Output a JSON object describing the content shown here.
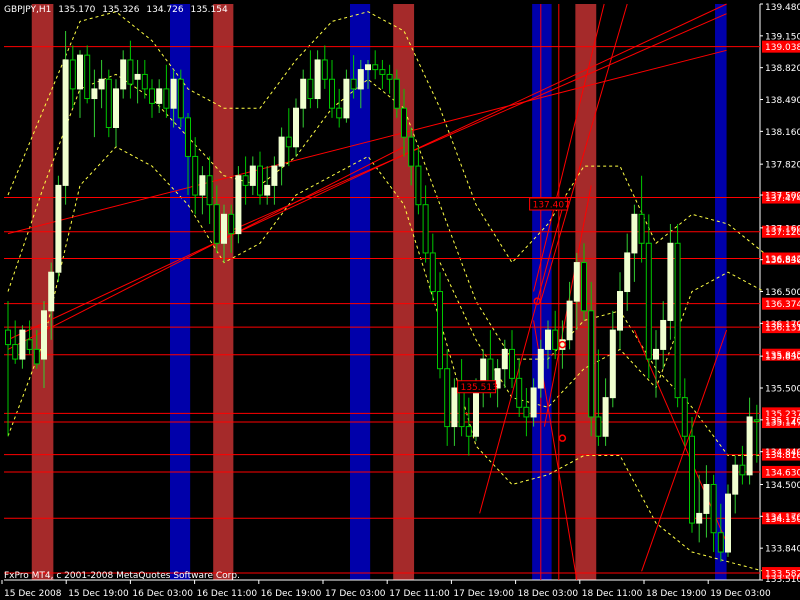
{
  "window": {
    "symbol": "GBPJPY,H1",
    "ohlc": [
      "135.170",
      "135.326",
      "134.726",
      "135.154"
    ],
    "copyright": "FxPro MT4, c 2001-2008 MetaQuotes Software Corp."
  },
  "colors": {
    "background": "#000000",
    "bull_body": "#f0ffd0",
    "bear_body": "#000000",
    "wick_bull": "#32cd32",
    "wick_bear": "#00c800",
    "band": "#ffff44",
    "line": "#ff0000",
    "red_zone": "#a52a2a",
    "blue_zone": "#0000aa",
    "label_bg": "#ff0000",
    "label_text": "#ffffff",
    "axis": "#ffffff"
  },
  "chart_data": {
    "type": "candlestick",
    "ylim": [
      133.51,
      139.48
    ],
    "y_ticks": [
      "139.480",
      "139.150",
      "138.820",
      "138.490",
      "138.160",
      "137.820",
      "137.500",
      "137.160",
      "136.830",
      "136.500",
      "136.170",
      "135.830",
      "135.500",
      "135.170",
      "134.840",
      "134.500",
      "134.170",
      "133.840",
      "133.510"
    ],
    "x_ticks": [
      "15 Dec 2008",
      "15 Dec 19:00",
      "16 Dec 03:00",
      "16 Dec 11:00",
      "16 Dec 19:00",
      "17 Dec 03:00",
      "17 Dec 11:00",
      "17 Dec 19:00",
      "18 Dec 03:00",
      "18 Dec 11:00",
      "18 Dec 19:00",
      "19 Dec 03:00"
    ],
    "candles": [
      {
        "t": 0,
        "o": 136.1,
        "h": 136.4,
        "l": 135.0,
        "c": 135.95
      },
      {
        "t": 1,
        "o": 135.95,
        "h": 136.2,
        "l": 135.75,
        "c": 135.8
      },
      {
        "t": 2,
        "o": 135.8,
        "h": 136.15,
        "l": 135.7,
        "c": 136.1
      },
      {
        "t": 3,
        "o": 136.0,
        "h": 136.2,
        "l": 135.85,
        "c": 135.9
      },
      {
        "t": 4,
        "o": 135.9,
        "h": 136.1,
        "l": 135.7,
        "c": 135.75
      },
      {
        "t": 5,
        "o": 135.8,
        "h": 136.4,
        "l": 135.5,
        "c": 136.3
      },
      {
        "t": 6,
        "o": 136.3,
        "h": 136.8,
        "l": 136.0,
        "c": 136.7
      },
      {
        "t": 7,
        "o": 136.7,
        "h": 137.7,
        "l": 136.6,
        "c": 137.6
      },
      {
        "t": 8,
        "o": 137.6,
        "h": 139.2,
        "l": 137.4,
        "c": 138.9
      },
      {
        "t": 9,
        "o": 138.9,
        "h": 139.05,
        "l": 138.4,
        "c": 138.6
      },
      {
        "t": 10,
        "o": 138.6,
        "h": 139.0,
        "l": 138.3,
        "c": 138.95
      },
      {
        "t": 11,
        "o": 138.95,
        "h": 139.05,
        "l": 138.45,
        "c": 138.5
      },
      {
        "t": 12,
        "o": 138.5,
        "h": 138.8,
        "l": 138.1,
        "c": 138.6
      },
      {
        "t": 13,
        "o": 138.6,
        "h": 138.9,
        "l": 138.4,
        "c": 138.7
      },
      {
        "t": 14,
        "o": 138.7,
        "h": 138.8,
        "l": 138.1,
        "c": 138.2
      },
      {
        "t": 15,
        "o": 138.2,
        "h": 138.7,
        "l": 138.0,
        "c": 138.6
      },
      {
        "t": 16,
        "o": 138.6,
        "h": 139.0,
        "l": 138.5,
        "c": 138.9
      },
      {
        "t": 17,
        "o": 138.9,
        "h": 139.1,
        "l": 138.5,
        "c": 138.65
      },
      {
        "t": 18,
        "o": 138.7,
        "h": 138.9,
        "l": 138.45,
        "c": 138.75
      },
      {
        "t": 19,
        "o": 138.75,
        "h": 138.9,
        "l": 138.5,
        "c": 138.6
      },
      {
        "t": 20,
        "o": 138.6,
        "h": 138.7,
        "l": 138.3,
        "c": 138.45
      },
      {
        "t": 21,
        "o": 138.45,
        "h": 138.7,
        "l": 138.35,
        "c": 138.6
      },
      {
        "t": 22,
        "o": 138.6,
        "h": 138.85,
        "l": 138.3,
        "c": 138.4
      },
      {
        "t": 23,
        "o": 138.4,
        "h": 138.8,
        "l": 138.2,
        "c": 138.7
      },
      {
        "t": 24,
        "o": 138.7,
        "h": 138.8,
        "l": 138.2,
        "c": 138.3
      },
      {
        "t": 25,
        "o": 138.3,
        "h": 138.35,
        "l": 137.5,
        "c": 137.9
      },
      {
        "t": 26,
        "o": 137.9,
        "h": 138.1,
        "l": 137.3,
        "c": 137.5
      },
      {
        "t": 27,
        "o": 137.5,
        "h": 137.8,
        "l": 137.3,
        "c": 137.7
      },
      {
        "t": 28,
        "o": 137.7,
        "h": 137.9,
        "l": 137.2,
        "c": 137.4
      },
      {
        "t": 29,
        "o": 137.4,
        "h": 137.6,
        "l": 136.9,
        "c": 137.0
      },
      {
        "t": 30,
        "o": 137.0,
        "h": 137.4,
        "l": 136.8,
        "c": 137.3
      },
      {
        "t": 31,
        "o": 137.3,
        "h": 137.4,
        "l": 136.9,
        "c": 137.1
      },
      {
        "t": 32,
        "o": 137.1,
        "h": 137.8,
        "l": 137.0,
        "c": 137.7
      },
      {
        "t": 33,
        "o": 137.7,
        "h": 137.9,
        "l": 137.4,
        "c": 137.6
      },
      {
        "t": 34,
        "o": 137.6,
        "h": 137.9,
        "l": 137.5,
        "c": 137.8
      },
      {
        "t": 35,
        "o": 137.8,
        "h": 137.95,
        "l": 137.4,
        "c": 137.5
      },
      {
        "t": 36,
        "o": 137.5,
        "h": 137.8,
        "l": 137.4,
        "c": 137.6
      },
      {
        "t": 37,
        "o": 137.6,
        "h": 137.9,
        "l": 137.4,
        "c": 137.8
      },
      {
        "t": 38,
        "o": 137.8,
        "h": 138.2,
        "l": 137.6,
        "c": 138.1
      },
      {
        "t": 39,
        "o": 138.1,
        "h": 138.4,
        "l": 137.8,
        "c": 138.0
      },
      {
        "t": 40,
        "o": 138.0,
        "h": 138.5,
        "l": 137.9,
        "c": 138.4
      },
      {
        "t": 41,
        "o": 138.4,
        "h": 138.8,
        "l": 138.2,
        "c": 138.7
      },
      {
        "t": 42,
        "o": 138.7,
        "h": 139.0,
        "l": 138.4,
        "c": 138.5
      },
      {
        "t": 43,
        "o": 138.5,
        "h": 139.0,
        "l": 138.4,
        "c": 138.9
      },
      {
        "t": 44,
        "o": 138.9,
        "h": 139.05,
        "l": 138.6,
        "c": 138.7
      },
      {
        "t": 45,
        "o": 138.7,
        "h": 138.9,
        "l": 138.3,
        "c": 138.4
      },
      {
        "t": 46,
        "o": 138.4,
        "h": 138.6,
        "l": 138.2,
        "c": 138.3
      },
      {
        "t": 47,
        "o": 138.3,
        "h": 138.8,
        "l": 138.25,
        "c": 138.7
      },
      {
        "t": 48,
        "o": 138.7,
        "h": 138.95,
        "l": 138.5,
        "c": 138.6
      },
      {
        "t": 49,
        "o": 138.6,
        "h": 138.9,
        "l": 138.4,
        "c": 138.8
      },
      {
        "t": 50,
        "o": 138.8,
        "h": 138.9,
        "l": 138.6,
        "c": 138.85
      },
      {
        "t": 51,
        "o": 138.85,
        "h": 139.0,
        "l": 138.7,
        "c": 138.8
      },
      {
        "t": 52,
        "o": 138.8,
        "h": 138.9,
        "l": 138.6,
        "c": 138.75
      },
      {
        "t": 53,
        "o": 138.75,
        "h": 138.85,
        "l": 138.55,
        "c": 138.7
      },
      {
        "t": 54,
        "o": 138.7,
        "h": 138.8,
        "l": 138.3,
        "c": 138.4
      },
      {
        "t": 55,
        "o": 138.4,
        "h": 138.6,
        "l": 137.9,
        "c": 138.1
      },
      {
        "t": 56,
        "o": 138.1,
        "h": 138.2,
        "l": 137.6,
        "c": 137.8
      },
      {
        "t": 57,
        "o": 137.8,
        "h": 138.0,
        "l": 137.3,
        "c": 137.4
      },
      {
        "t": 58,
        "o": 137.4,
        "h": 137.6,
        "l": 136.8,
        "c": 136.9
      },
      {
        "t": 59,
        "o": 136.9,
        "h": 137.1,
        "l": 136.4,
        "c": 136.5
      },
      {
        "t": 60,
        "o": 136.5,
        "h": 136.7,
        "l": 135.6,
        "c": 135.7
      },
      {
        "t": 61,
        "o": 135.7,
        "h": 135.9,
        "l": 134.9,
        "c": 135.1
      },
      {
        "t": 62,
        "o": 135.1,
        "h": 135.6,
        "l": 134.9,
        "c": 135.5
      },
      {
        "t": 63,
        "o": 135.5,
        "h": 135.8,
        "l": 135.0,
        "c": 135.1
      },
      {
        "t": 64,
        "o": 135.1,
        "h": 135.4,
        "l": 134.8,
        "c": 135.0
      },
      {
        "t": 65,
        "o": 135.0,
        "h": 135.6,
        "l": 134.95,
        "c": 135.5
      },
      {
        "t": 66,
        "o": 135.5,
        "h": 135.9,
        "l": 135.3,
        "c": 135.8
      },
      {
        "t": 67,
        "o": 135.8,
        "h": 136.1,
        "l": 135.4,
        "c": 135.5
      },
      {
        "t": 68,
        "o": 135.5,
        "h": 135.8,
        "l": 135.3,
        "c": 135.7
      },
      {
        "t": 69,
        "o": 135.7,
        "h": 136.0,
        "l": 135.5,
        "c": 135.9
      },
      {
        "t": 70,
        "o": 135.9,
        "h": 136.1,
        "l": 135.5,
        "c": 135.6
      },
      {
        "t": 71,
        "o": 135.6,
        "h": 135.8,
        "l": 135.2,
        "c": 135.3
      },
      {
        "t": 72,
        "o": 135.3,
        "h": 135.5,
        "l": 135.0,
        "c": 135.2
      },
      {
        "t": 73,
        "o": 135.2,
        "h": 135.6,
        "l": 135.1,
        "c": 135.5
      },
      {
        "t": 74,
        "o": 135.5,
        "h": 136.0,
        "l": 135.4,
        "c": 135.9
      },
      {
        "t": 75,
        "o": 135.9,
        "h": 136.2,
        "l": 135.7,
        "c": 136.1
      },
      {
        "t": 76,
        "o": 136.1,
        "h": 136.3,
        "l": 135.8,
        "c": 135.9
      },
      {
        "t": 77,
        "o": 135.9,
        "h": 136.2,
        "l": 135.7,
        "c": 136.0
      },
      {
        "t": 78,
        "o": 136.0,
        "h": 136.6,
        "l": 135.9,
        "c": 136.4
      },
      {
        "t": 79,
        "o": 136.4,
        "h": 136.9,
        "l": 136.1,
        "c": 136.8
      },
      {
        "t": 80,
        "o": 136.8,
        "h": 137.0,
        "l": 136.2,
        "c": 136.3
      },
      {
        "t": 81,
        "o": 136.3,
        "h": 136.6,
        "l": 135.0,
        "c": 135.2
      },
      {
        "t": 82,
        "o": 135.2,
        "h": 135.9,
        "l": 134.9,
        "c": 135.0
      },
      {
        "t": 83,
        "o": 135.0,
        "h": 135.6,
        "l": 134.9,
        "c": 135.4
      },
      {
        "t": 84,
        "o": 135.4,
        "h": 136.3,
        "l": 135.3,
        "c": 136.1
      },
      {
        "t": 85,
        "o": 136.1,
        "h": 136.7,
        "l": 135.9,
        "c": 136.5
      },
      {
        "t": 86,
        "o": 136.5,
        "h": 137.1,
        "l": 136.3,
        "c": 136.9
      },
      {
        "t": 87,
        "o": 136.9,
        "h": 137.4,
        "l": 136.6,
        "c": 137.3
      },
      {
        "t": 88,
        "o": 137.3,
        "h": 137.7,
        "l": 136.8,
        "c": 137.0
      },
      {
        "t": 89,
        "o": 137.0,
        "h": 137.3,
        "l": 135.6,
        "c": 135.8
      },
      {
        "t": 90,
        "o": 135.8,
        "h": 136.1,
        "l": 135.4,
        "c": 135.9
      },
      {
        "t": 91,
        "o": 135.9,
        "h": 136.4,
        "l": 135.7,
        "c": 136.2
      },
      {
        "t": 92,
        "o": 136.2,
        "h": 137.2,
        "l": 136.0,
        "c": 137.0
      },
      {
        "t": 93,
        "o": 137.0,
        "h": 137.2,
        "l": 135.3,
        "c": 135.4
      },
      {
        "t": 94,
        "o": 135.4,
        "h": 135.6,
        "l": 134.9,
        "c": 135.0
      },
      {
        "t": 95,
        "o": 135.0,
        "h": 135.2,
        "l": 134.0,
        "c": 134.1
      },
      {
        "t": 96,
        "o": 134.1,
        "h": 134.6,
        "l": 133.9,
        "c": 134.2
      },
      {
        "t": 97,
        "o": 134.2,
        "h": 134.7,
        "l": 133.95,
        "c": 134.5
      },
      {
        "t": 98,
        "o": 134.5,
        "h": 134.6,
        "l": 133.8,
        "c": 134.0
      },
      {
        "t": 99,
        "o": 134.0,
        "h": 134.3,
        "l": 133.7,
        "c": 133.8
      },
      {
        "t": 100,
        "o": 133.8,
        "h": 134.5,
        "l": 133.75,
        "c": 134.4
      },
      {
        "t": 101,
        "o": 134.4,
        "h": 134.8,
        "l": 134.2,
        "c": 134.7
      },
      {
        "t": 102,
        "o": 134.7,
        "h": 134.9,
        "l": 134.5,
        "c": 134.6
      },
      {
        "t": 103,
        "o": 134.6,
        "h": 135.4,
        "l": 134.5,
        "c": 135.2
      },
      {
        "t": 104,
        "o": 135.17,
        "h": 135.326,
        "l": 134.726,
        "c": 135.154
      }
    ],
    "zones": [
      {
        "color": "red_zone",
        "from": 3.3,
        "to": 6.3
      },
      {
        "color": "blue_zone",
        "from": 22.5,
        "to": 25.3
      },
      {
        "color": "red_zone",
        "from": 28.5,
        "to": 31.3
      },
      {
        "color": "blue_zone",
        "from": 47.5,
        "to": 50.3
      },
      {
        "color": "red_zone",
        "from": 53.5,
        "to": 56.4
      },
      {
        "color": "blue_zone",
        "from": 72.8,
        "to": 75.5
      },
      {
        "color": "red_zone",
        "from": 78.8,
        "to": 81.7
      },
      {
        "color": "blue_zone",
        "from": 98.2,
        "to": 99.8
      }
    ],
    "hlines": [
      {
        "price": 139.038,
        "label": "139.038"
      },
      {
        "price": 137.474,
        "label": "137.474"
      },
      {
        "price": 137.12,
        "label": "137.120"
      },
      {
        "price": 136.842,
        "label": "136.842"
      },
      {
        "price": 136.374,
        "label": "136.374"
      },
      {
        "price": 136.131,
        "label": "136.131"
      },
      {
        "price": 135.845,
        "label": "135.845"
      },
      {
        "price": 135.237,
        "label": "135.237"
      },
      {
        "price": 135.147,
        "label": "135.147"
      },
      {
        "price": 134.81,
        "label": "134.810"
      },
      {
        "price": 134.63,
        "label": "134.630"
      },
      {
        "price": 134.15,
        "label": "134.150"
      },
      {
        "price": 133.582,
        "label": "133.582"
      }
    ],
    "trendlines": [
      {
        "t1": 0,
        "p1": 136.0,
        "t2": 99.8,
        "p2": 139.48
      },
      {
        "t1": 0,
        "p1": 137.1,
        "t2": 99.8,
        "p2": 139.0
      },
      {
        "t1": 30.0,
        "p1": 137.1,
        "t2": 99.8,
        "p2": 139.38
      },
      {
        "t1": 0,
        "p1": 135.9,
        "t2": 55.0,
        "p2": 138.0
      },
      {
        "t1": 65.5,
        "p1": 134.2,
        "t2": 77.5,
        "p2": 137.5
      },
      {
        "t1": 73.0,
        "p1": 136.5,
        "t2": 82.8,
        "p2": 139.48
      },
      {
        "t1": 74.0,
        "p1": 136.4,
        "t2": 86.0,
        "p2": 139.48
      },
      {
        "t1": 74.5,
        "p1": 135.1,
        "t2": 81.0,
        "p2": 137.6
      },
      {
        "t1": 73.0,
        "p1": 136.2,
        "t2": 79.0,
        "p2": 133.51
      },
      {
        "t1": 87.0,
        "p1": 136.1,
        "t2": 99.8,
        "p2": 133.9
      },
      {
        "t1": 88.0,
        "p1": 133.6,
        "t2": 99.8,
        "p2": 136.1
      }
    ],
    "vlines": [
      74.0,
      76.5
    ],
    "band_upper": [
      [
        0,
        137.5
      ],
      [
        5,
        138.4
      ],
      [
        10,
        139.3
      ],
      [
        15,
        139.4
      ],
      [
        20,
        139.1
      ],
      [
        25,
        138.6
      ],
      [
        30,
        138.4
      ],
      [
        35,
        138.4
      ],
      [
        40,
        138.9
      ],
      [
        45,
        139.3
      ],
      [
        50,
        139.4
      ],
      [
        55,
        139.2
      ],
      [
        60,
        138.4
      ],
      [
        65,
        137.4
      ],
      [
        70,
        136.8
      ],
      [
        75,
        137.2
      ],
      [
        80,
        137.8
      ],
      [
        85,
        137.8
      ],
      [
        90,
        137.0
      ],
      [
        95,
        137.3
      ],
      [
        100,
        137.2
      ],
      [
        105,
        136.9
      ]
    ],
    "band_middle": [
      [
        0,
        136.5
      ],
      [
        5,
        137.6
      ],
      [
        10,
        138.6
      ],
      [
        15,
        138.75
      ],
      [
        20,
        138.5
      ],
      [
        25,
        138.1
      ],
      [
        30,
        137.7
      ],
      [
        35,
        137.6
      ],
      [
        40,
        137.9
      ],
      [
        45,
        138.4
      ],
      [
        50,
        138.7
      ],
      [
        55,
        138.4
      ],
      [
        60,
        137.4
      ],
      [
        65,
        136.4
      ],
      [
        70,
        135.8
      ],
      [
        75,
        135.8
      ],
      [
        80,
        136.2
      ],
      [
        85,
        136.3
      ],
      [
        90,
        135.7
      ],
      [
        95,
        135.3
      ],
      [
        100,
        134.8
      ],
      [
        105,
        134.8
      ]
    ],
    "band_lower": [
      [
        0,
        135.0
      ],
      [
        5,
        136.0
      ],
      [
        10,
        137.6
      ],
      [
        15,
        138.0
      ],
      [
        20,
        137.8
      ],
      [
        25,
        137.4
      ],
      [
        30,
        136.8
      ],
      [
        35,
        137.0
      ],
      [
        40,
        137.5
      ],
      [
        45,
        137.7
      ],
      [
        50,
        137.9
      ],
      [
        55,
        137.4
      ],
      [
        60,
        136.2
      ],
      [
        65,
        134.9
      ],
      [
        70,
        134.5
      ],
      [
        75,
        134.6
      ],
      [
        80,
        134.8
      ],
      [
        85,
        134.8
      ],
      [
        90,
        134.1
      ],
      [
        95,
        133.8
      ],
      [
        100,
        133.7
      ],
      [
        105,
        133.6
      ]
    ],
    "band_outer": [
      [
        60,
        136.8
      ],
      [
        65,
        136.0
      ],
      [
        70,
        135.4
      ],
      [
        75,
        135.3
      ],
      [
        80,
        135.7
      ],
      [
        85,
        135.9
      ],
      [
        90,
        135.5
      ],
      [
        95,
        136.5
      ],
      [
        100,
        136.7
      ],
      [
        105,
        136.5
      ]
    ],
    "annotations": [
      {
        "t": 78.0,
        "p": 137.407,
        "label": "137.407"
      },
      {
        "t": 68.0,
        "p": 135.513,
        "label": "135.513"
      }
    ],
    "markers": [
      {
        "t": 73.5,
        "p": 136.4
      },
      {
        "t": 77.0,
        "p": 135.95
      },
      {
        "t": 77.0,
        "p": 134.98
      }
    ]
  }
}
